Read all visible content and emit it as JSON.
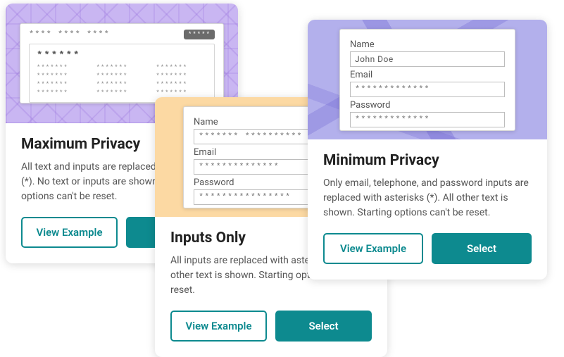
{
  "buttons": {
    "view_example": "View Example",
    "select": "Select"
  },
  "cards": {
    "maximum": {
      "title": "Maximum Privacy",
      "desc": "All text and inputs are replaced with asterisks (*). No text or inputs are shown. Starting options can't be reset.",
      "mock": {
        "topbar": "**** **** ****",
        "badge": "*****",
        "panel_title": "******",
        "cells": [
          "*******",
          "*******",
          "*******",
          "*******",
          "*******",
          "*******",
          "*******",
          "*******",
          "*******",
          "*******",
          "*******",
          "*******"
        ]
      }
    },
    "inputs": {
      "title": "Inputs Only",
      "desc": "All inputs are replaced with asterisks (*). All other text is shown. Starting options can't be reset.",
      "form": {
        "name_label": "Name",
        "name_value": "******* **********",
        "email_label": "Email",
        "email_value": "**************",
        "password_label": "Password",
        "password_value": "****************"
      }
    },
    "minimum": {
      "title": "Minimum Privacy",
      "desc": "Only email, telephone, and password inputs are replaced with asterisks (*). All other text is shown. Starting options can't be reset.",
      "form": {
        "name_label": "Name",
        "name_value": "John  Doe",
        "email_label": "Email",
        "email_value": "*************",
        "password_label": "Password",
        "password_value": "*************"
      }
    }
  }
}
